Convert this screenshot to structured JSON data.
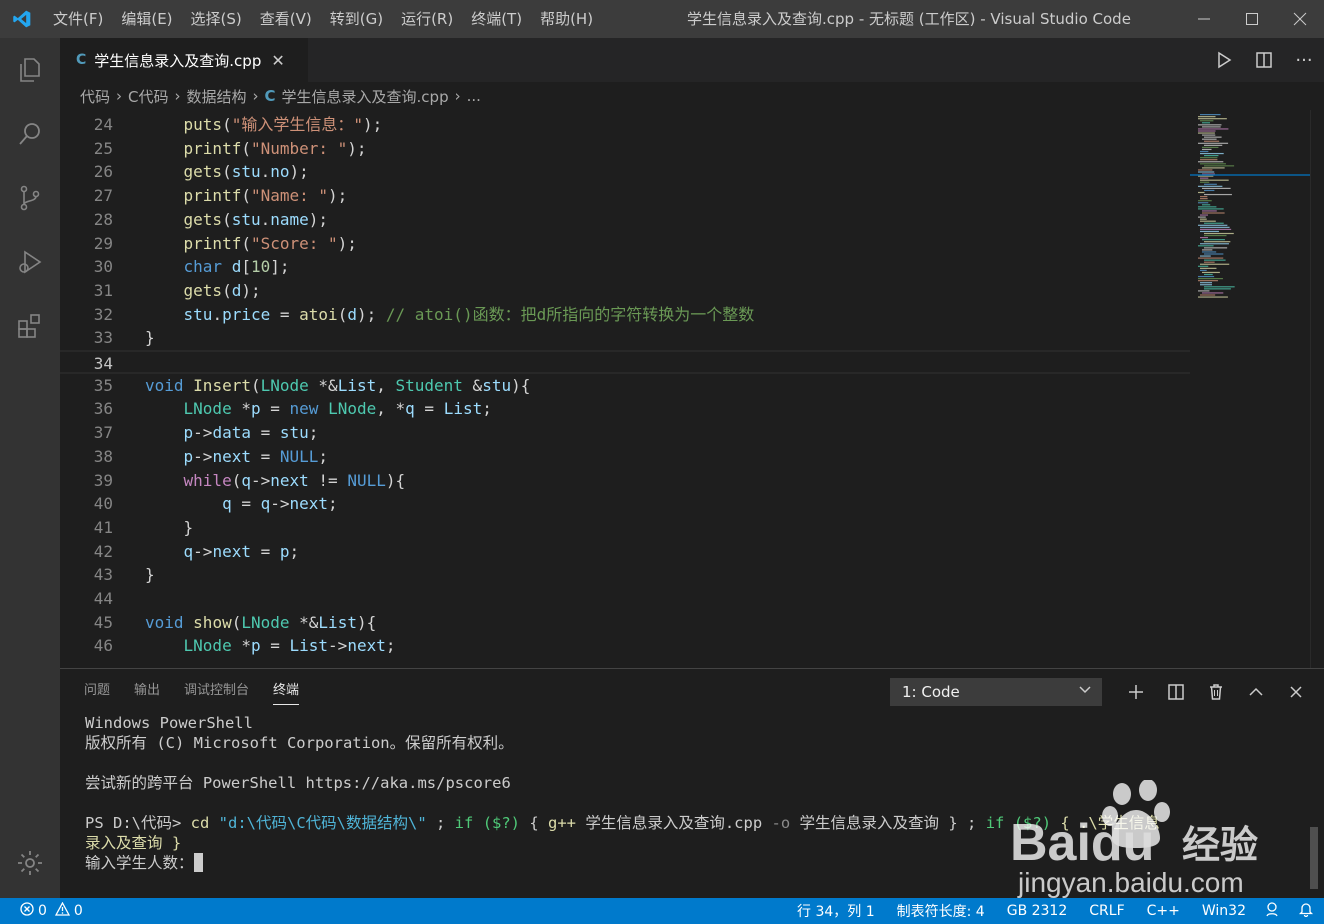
{
  "window": {
    "title": "学生信息录入及查询.cpp - 无标题 (工作区) - Visual Studio Code"
  },
  "menu": [
    "文件(F)",
    "编辑(E)",
    "选择(S)",
    "查看(V)",
    "转到(G)",
    "运行(R)",
    "终端(T)",
    "帮助(H)"
  ],
  "tab": {
    "label": "学生信息录入及查询.cpp",
    "icon": "C"
  },
  "breadcrumb": {
    "parts": [
      "代码",
      "C代码",
      "数据结构"
    ],
    "file": "学生信息录入及查询.cpp",
    "more": "..."
  },
  "editor": {
    "current_line": "34",
    "lines": [
      {
        "n": "24",
        "code": "    puts(\"输入学生信息：\");"
      },
      {
        "n": "25",
        "code": "    printf(\"Number: \");"
      },
      {
        "n": "26",
        "code": "    gets(stu.no);"
      },
      {
        "n": "27",
        "code": "    printf(\"Name: \");"
      },
      {
        "n": "28",
        "code": "    gets(stu.name);"
      },
      {
        "n": "29",
        "code": "    printf(\"Score: \");"
      },
      {
        "n": "30",
        "code": "    char d[10];"
      },
      {
        "n": "31",
        "code": "    gets(d);"
      },
      {
        "n": "32",
        "code": "    stu.price = atoi(d); // atoi()函数：把d所指向的字符转换为一个整数"
      },
      {
        "n": "33",
        "code": "}"
      },
      {
        "n": "34",
        "code": ""
      },
      {
        "n": "35",
        "code": "void Insert(LNode *&List, Student &stu){"
      },
      {
        "n": "36",
        "code": "    LNode *p = new LNode, *q = List;"
      },
      {
        "n": "37",
        "code": "    p->data = stu;"
      },
      {
        "n": "38",
        "code": "    p->next = NULL;"
      },
      {
        "n": "39",
        "code": "    while(q->next != NULL){"
      },
      {
        "n": "40",
        "code": "        q = q->next;"
      },
      {
        "n": "41",
        "code": "    }"
      },
      {
        "n": "42",
        "code": "    q->next = p;"
      },
      {
        "n": "43",
        "code": "}"
      },
      {
        "n": "44",
        "code": ""
      },
      {
        "n": "45",
        "code": "void show(LNode *&List){"
      },
      {
        "n": "46",
        "code": "    LNode *p = List->next;"
      }
    ]
  },
  "panel": {
    "tabs": [
      "问题",
      "输出",
      "调试控制台",
      "终端"
    ],
    "active_tab": "终端",
    "terminal_select": "1: Code",
    "terminal": {
      "line1": "Windows PowerShell",
      "line2": "版权所有 (C) Microsoft Corporation。保留所有权利。",
      "line3": "尝试新的跨平台 PowerShell https://aka.ms/pscore6",
      "prompt": "PS D:\\代码> ",
      "cmd_cd": "cd",
      "cmd_path": "\"d:\\代码\\C代码\\数据结构\\\"",
      "cmd_sep1": " ; ",
      "cmd_if": "if",
      "cmd_var1": "($?)",
      "cmd_brace1": " { ",
      "cmd_gpp": "g++",
      "cmd_src": " 学生信息录入及查询.cpp ",
      "cmd_o": "-o",
      "cmd_out": " 学生信息录入及查询 } ; ",
      "cmd_if2": "if",
      "cmd_var2": "($?)",
      "cmd_tail1": " { .\\学生信息",
      "cmd_tail2": "录入及查询 }",
      "input_prompt": "输入学生人数："
    }
  },
  "status": {
    "errors": "0",
    "warnings": "0",
    "position": "行 34，列 1",
    "tab_size": "制表符长度: 4",
    "encoding": "GB 2312",
    "eol": "CRLF",
    "language": "C++",
    "platform": "Win32"
  },
  "watermark": {
    "brand": "Baidu",
    "brand_cn": "经验",
    "url": "jingyan.baidu.com"
  }
}
